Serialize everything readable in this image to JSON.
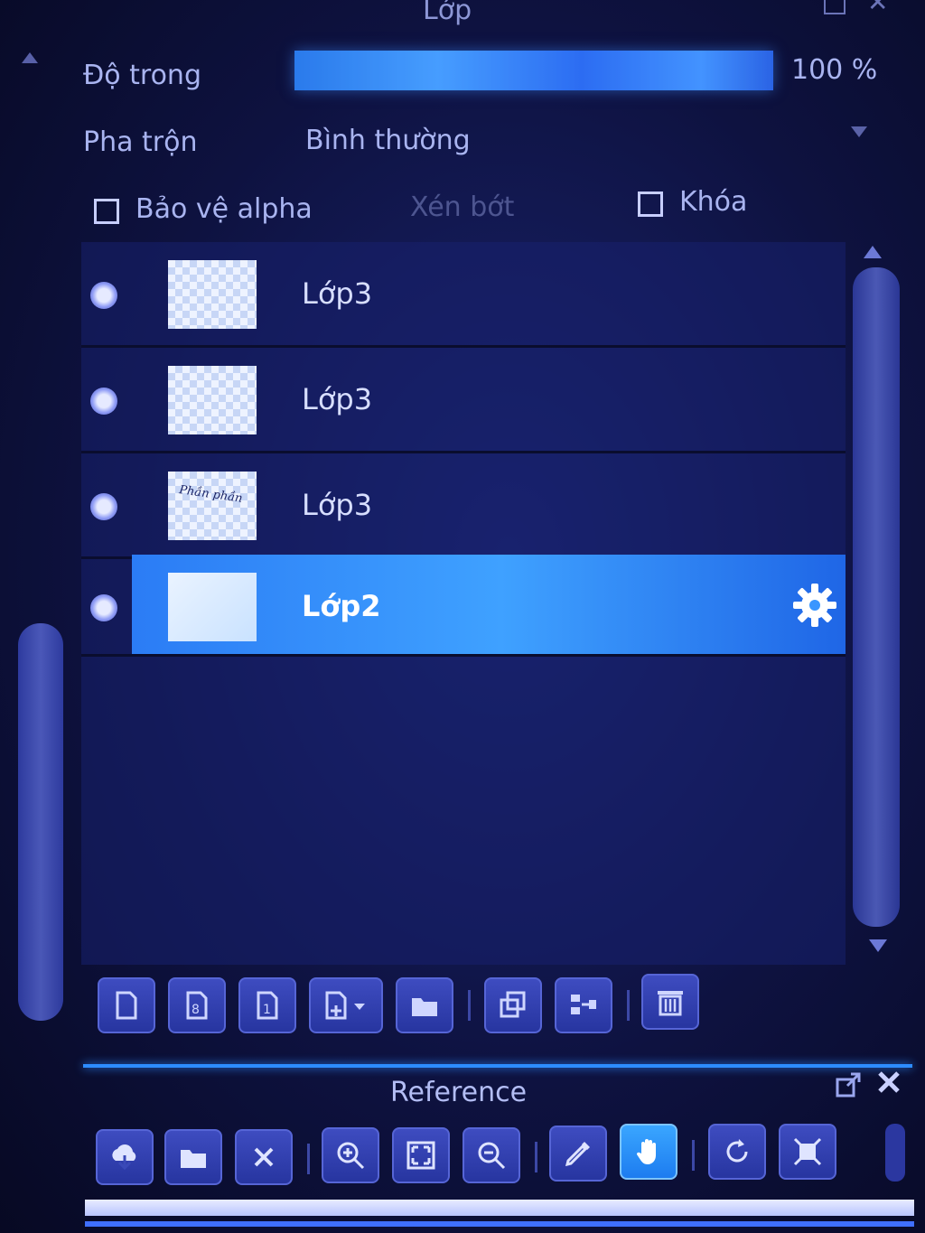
{
  "panel": {
    "title": "Lớp"
  },
  "opacity": {
    "label": "Độ trong",
    "value_text": "100 %",
    "value": 100
  },
  "blend": {
    "label": "Pha trộn",
    "value": "Bình thường"
  },
  "options": {
    "protect_alpha": "Bảo vệ alpha",
    "clipping": "Xén bớt",
    "lock": "Khóa"
  },
  "layers": [
    {
      "name": "Lớp3",
      "visible": true,
      "selected": false
    },
    {
      "name": "Lớp3",
      "visible": true,
      "selected": false
    },
    {
      "name": "Lớp3",
      "visible": true,
      "selected": false,
      "thumb_text": "Phần phần"
    },
    {
      "name": "Lớp2",
      "visible": true,
      "selected": true
    }
  ],
  "layer_toolbar": [
    "new-layer-icon",
    "new-8bit-layer-icon",
    "new-1bit-layer-icon",
    "add-layer-dropdown-icon",
    "new-folder-icon",
    "duplicate-layer-icon",
    "merge-layer-icon",
    "delete-layer-icon"
  ],
  "reference": {
    "title": "Reference",
    "toolbar": [
      "open-cloud-icon",
      "open-folder-icon",
      "close-icon",
      "zoom-in-icon",
      "fit-icon",
      "zoom-out-icon",
      "eyedropper-icon",
      "hand-icon",
      "rotate-icon",
      "fit-window-icon"
    ]
  },
  "colors": {
    "accent": "#2b7cf5",
    "selected_row": "#3fa1ff",
    "text": "#a9b4f0"
  }
}
